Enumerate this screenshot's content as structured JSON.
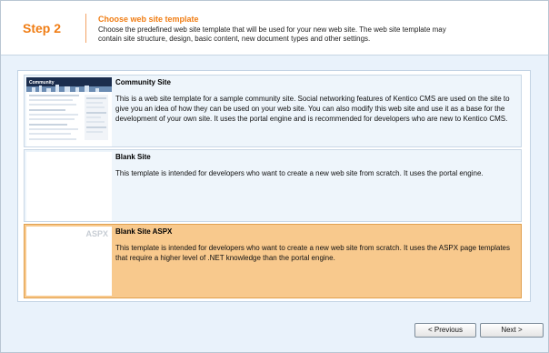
{
  "header": {
    "step": "Step 2",
    "title": "Choose web site template",
    "description": "Choose the predefined web site template that will be used for your new web site. The web site template may contain site structure, design, basic content, new document types and other settings."
  },
  "templates": [
    {
      "title": "Community Site",
      "description": "This is a web site template for a sample community site. Social networking features of Kentico CMS are used on the site to give you an idea of how they can be used on your web site. You can also modify this web site and use it as a base for the development of your own site. It uses the portal engine and is recommended for developers who are new to Kentico CMS.",
      "thumbnail_text": "Community"
    },
    {
      "title": "Blank Site",
      "description": "This template is intended for developers who want to create a new web site from scratch. It uses the portal engine."
    },
    {
      "title": "Blank Site ASPX",
      "description": "This template is intended for developers who want to create a new web site from scratch. It uses the ASPX page templates that require a higher level of .NET knowledge than the portal engine.",
      "thumbnail_label": "ASPX",
      "selected": true
    }
  ],
  "buttons": {
    "previous": "< Previous",
    "next": "Next >"
  }
}
